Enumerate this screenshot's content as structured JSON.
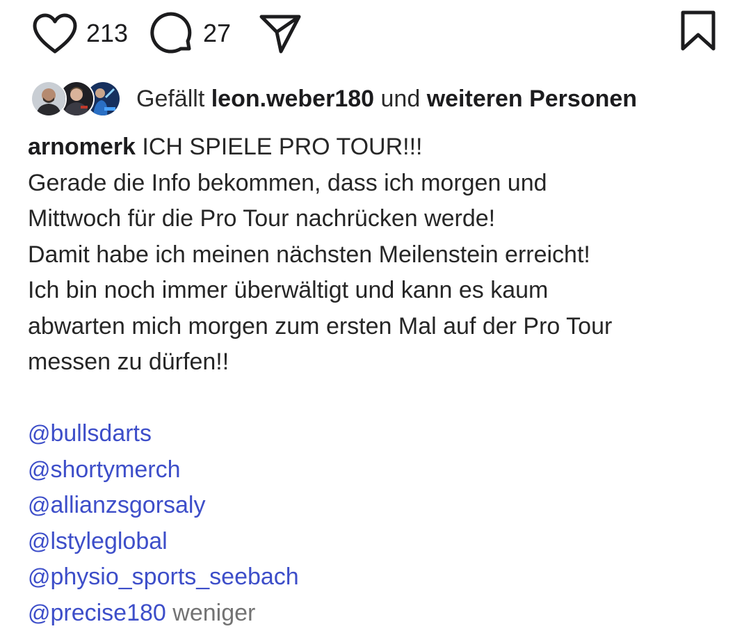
{
  "actions": {
    "like_count": "213",
    "comment_count": "27"
  },
  "likes": {
    "prefix": "Gefällt",
    "user": "leon.weber180",
    "conjunction": "und",
    "others": "weiteren Personen"
  },
  "caption": {
    "author": "arnomerk",
    "lines": [
      "ICH SPIELE PRO TOUR!!!",
      "Gerade die Info bekommen, dass ich morgen und",
      "Mittwoch für die Pro Tour nachrücken werde!",
      "Damit habe ich meinen nächsten Meilenstein erreicht!",
      "Ich bin noch immer überwältigt und kann es kaum",
      "abwarten mich morgen zum ersten Mal auf der Pro Tour",
      "messen zu dürfen!!"
    ],
    "mention_prefix": "@",
    "mentions": [
      "bullsdarts",
      "shortymerch",
      "allianzsgorsaly",
      "lstyleglobal",
      "physio_sports_seebach",
      "precise180"
    ],
    "less_label": "weniger"
  },
  "colors": {
    "text": "#1c1c1e",
    "mention": "#3d4ec9",
    "muted": "#737373"
  },
  "icons": {
    "like": "heart-icon",
    "comment": "comment-bubble-icon",
    "share": "paper-plane-icon",
    "save": "bookmark-icon"
  }
}
